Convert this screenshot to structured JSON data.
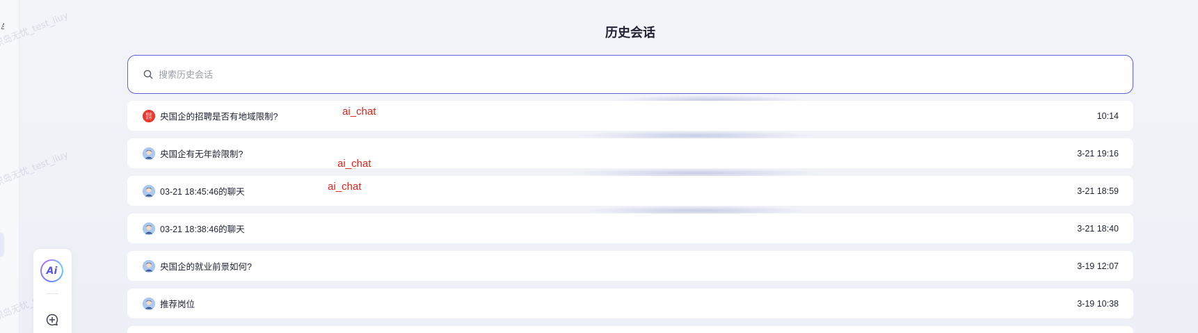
{
  "page": {
    "title": "历史会话"
  },
  "search": {
    "placeholder": "搜索历史会话"
  },
  "sessions": [
    {
      "title": "央国企的招聘是否有地域限制?",
      "time": "10:14",
      "avatar": "logo",
      "avatar_text": "职途\n云谷"
    },
    {
      "title": "央国企有无年龄限制?",
      "time": "3-21 19:16",
      "avatar": "user"
    },
    {
      "title": "03-21 18:45:46的聊天",
      "time": "3-21 18:59",
      "avatar": "user"
    },
    {
      "title": "03-21 18:38:46的聊天",
      "time": "3-21 18:40",
      "avatar": "user"
    },
    {
      "title": "央国企的就业前景如何?",
      "time": "3-19 12:07",
      "avatar": "user"
    },
    {
      "title": "推荐岗位",
      "time": "3-19 10:38",
      "avatar": "user"
    }
  ],
  "annotations": [
    "ai_chat",
    "ai_chat",
    "ai_chat"
  ],
  "watermarks": [
    "职岛无忧_test_liuy",
    "职岛无忧_test_liuy",
    "职岛无忧_test_liuy"
  ],
  "tool_panel": {
    "ai_label": "Ai"
  },
  "colors": {
    "accent": "#5b5fdc",
    "annotation": "#e0221a",
    "logo": "#e8392f"
  }
}
